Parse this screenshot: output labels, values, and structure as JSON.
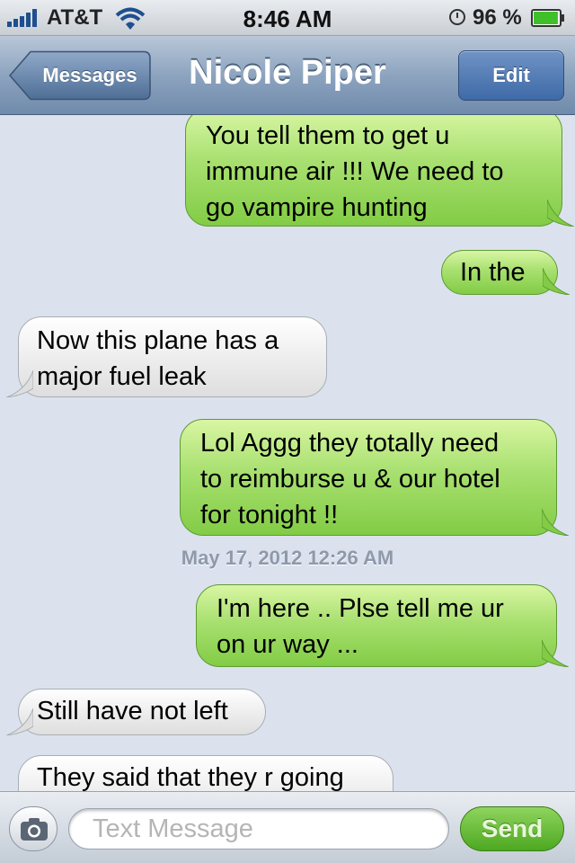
{
  "status_bar": {
    "carrier": "AT&T",
    "time": "8:46 AM",
    "battery_percent": "96 %",
    "battery_level": 0.96
  },
  "nav": {
    "back_label": "Messages",
    "title": "Nicole Piper",
    "edit_label": "Edit"
  },
  "messages": [
    {
      "direction": "sent",
      "text": "You tell them to get u immune air !!! We need to go vampire hunting"
    },
    {
      "direction": "sent",
      "text": "In the"
    },
    {
      "direction": "received",
      "text": "Now this plane has a major fuel leak"
    },
    {
      "direction": "sent",
      "text": "Lol Aggg they totally need to reimburse u & our hotel for tonight !!"
    },
    {
      "direction": "sent",
      "text": "I'm here .. Plse tell me ur on ur way ..."
    },
    {
      "direction": "received",
      "text": "Still have not left"
    },
    {
      "direction": "received",
      "text": "They said that they r going"
    }
  ],
  "timestamp": "May 17, 2012 12:26 AM",
  "input": {
    "placeholder": "Text Message",
    "send_label": "Send"
  },
  "colors": {
    "sent_bubble": "#a8e070",
    "received_bubble": "#eeeeee",
    "background": "#dbe2ed",
    "nav_bar": "#8da4bf",
    "send_button": "#4da821"
  },
  "icons": {
    "signal": "signal-bars-icon",
    "wifi": "wifi-icon",
    "clock": "clock-icon",
    "battery": "battery-icon",
    "back": "back-arrow-icon",
    "camera": "camera-icon"
  }
}
